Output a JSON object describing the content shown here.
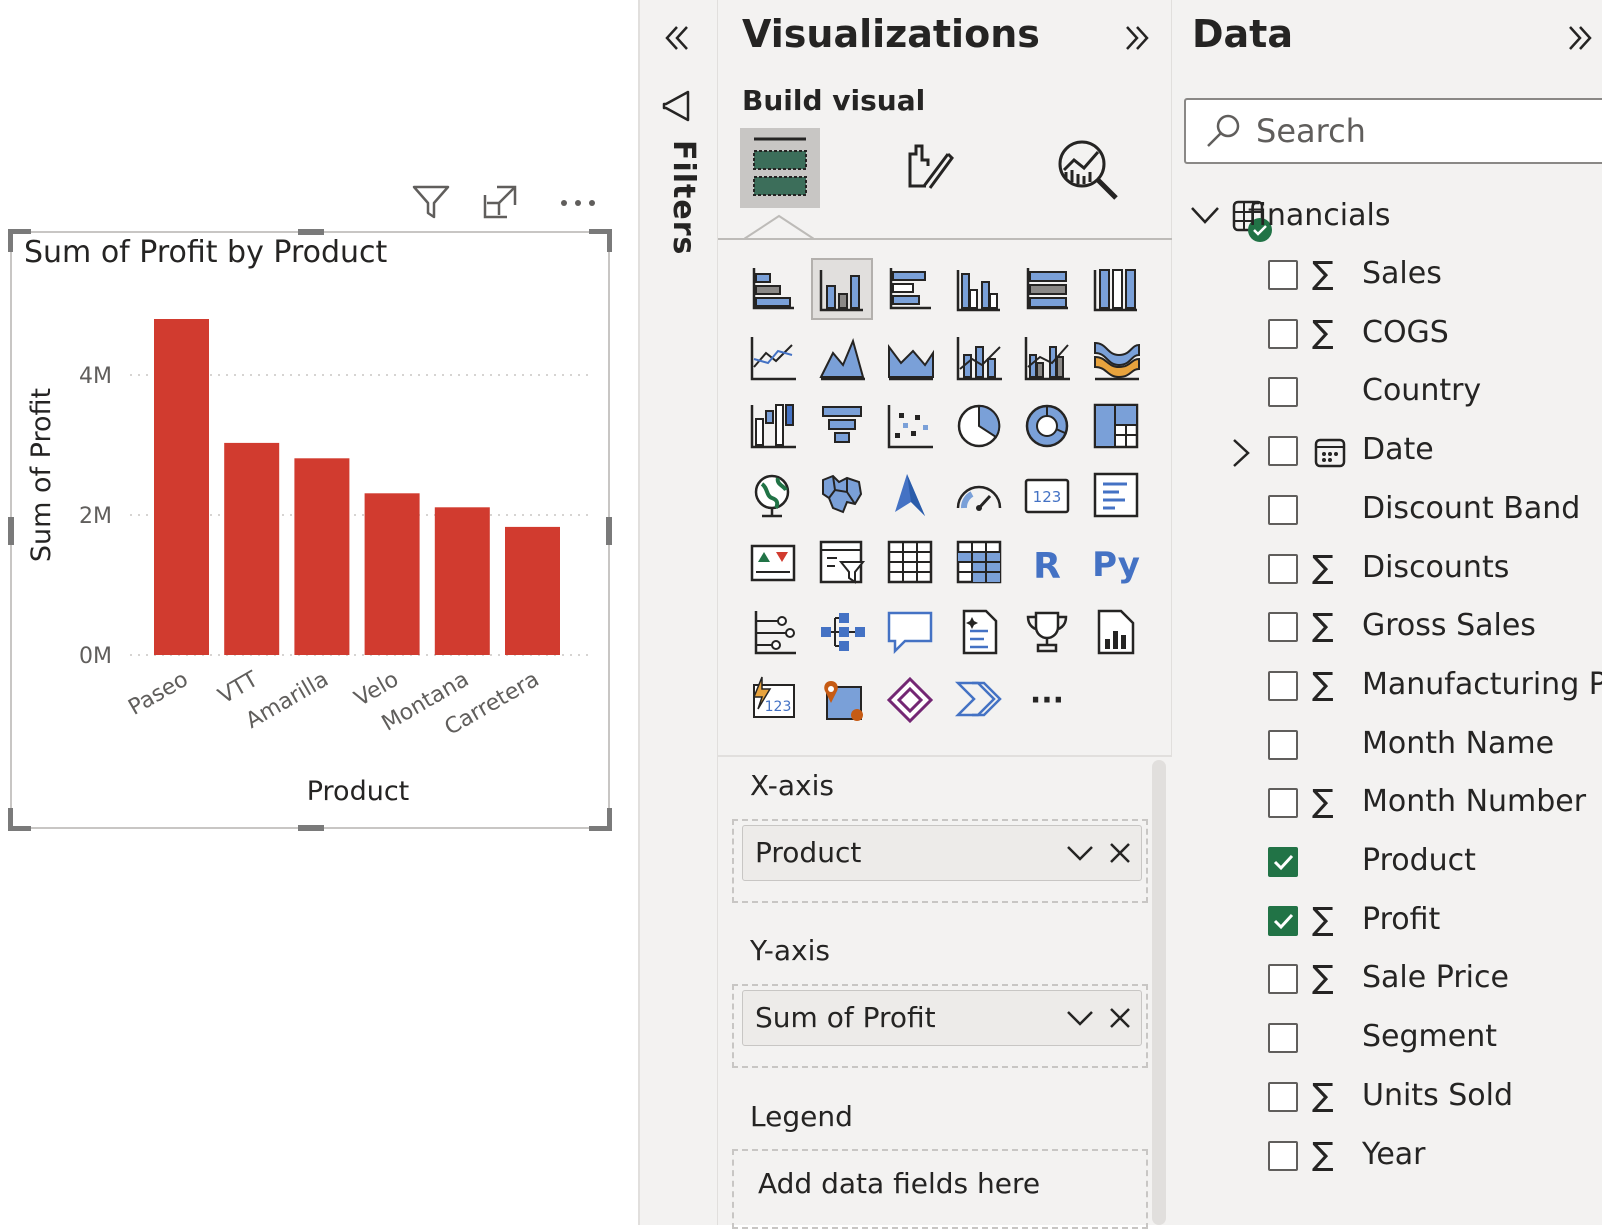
{
  "report": {
    "visual_header_icons": [
      "filter-icon",
      "focus-mode-icon",
      "more-options-icon"
    ]
  },
  "chart_data": {
    "type": "bar",
    "title": "Sum of Profit by Product",
    "xlabel": "Product",
    "ylabel": "Sum of Profit",
    "categories": [
      "Paseo",
      "VTT",
      "Amarilla",
      "Velo",
      "Montana",
      "Carretera"
    ],
    "values": [
      4.8,
      3.03,
      2.81,
      2.31,
      2.11,
      1.83
    ],
    "ylim": [
      0,
      5
    ],
    "yticks": [
      0,
      2,
      4
    ],
    "ytick_labels": [
      "0M",
      "2M",
      "4M"
    ],
    "grid": true,
    "bar_color": "#d13b2f"
  },
  "filters": {
    "label": "Filters"
  },
  "visualizations": {
    "title": "Visualizations",
    "build_label": "Build visual",
    "tabs": [
      "build-visual",
      "format-visual",
      "analytics"
    ],
    "more_label": "···",
    "wells": [
      {
        "label": "X-axis",
        "field": "Product"
      },
      {
        "label": "Y-axis",
        "field": "Sum of Profit"
      },
      {
        "label": "Legend",
        "placeholder": "Add data fields here"
      }
    ]
  },
  "data_pane": {
    "title": "Data",
    "search_placeholder": "Search",
    "table_name": "financials",
    "fields": [
      {
        "name": "Sales",
        "sigma": true,
        "checked": false
      },
      {
        "name": "COGS",
        "sigma": true,
        "checked": false
      },
      {
        "name": "Country",
        "sigma": false,
        "checked": false
      },
      {
        "name": "Date",
        "sigma": false,
        "checked": false,
        "calendar": true,
        "expandable": true
      },
      {
        "name": "Discount Band",
        "sigma": false,
        "checked": false
      },
      {
        "name": "Discounts",
        "sigma": true,
        "checked": false
      },
      {
        "name": "Gross Sales",
        "sigma": true,
        "checked": false
      },
      {
        "name": "Manufacturing P...",
        "sigma": true,
        "checked": false
      },
      {
        "name": "Month Name",
        "sigma": false,
        "checked": false
      },
      {
        "name": "Month Number",
        "sigma": true,
        "checked": false
      },
      {
        "name": "Product",
        "sigma": false,
        "checked": true
      },
      {
        "name": "Profit",
        "sigma": true,
        "checked": true
      },
      {
        "name": "Sale Price",
        "sigma": true,
        "checked": false
      },
      {
        "name": "Segment",
        "sigma": false,
        "checked": false
      },
      {
        "name": "Units Sold",
        "sigma": true,
        "checked": false
      },
      {
        "name": "Year",
        "sigma": true,
        "checked": false
      }
    ]
  }
}
